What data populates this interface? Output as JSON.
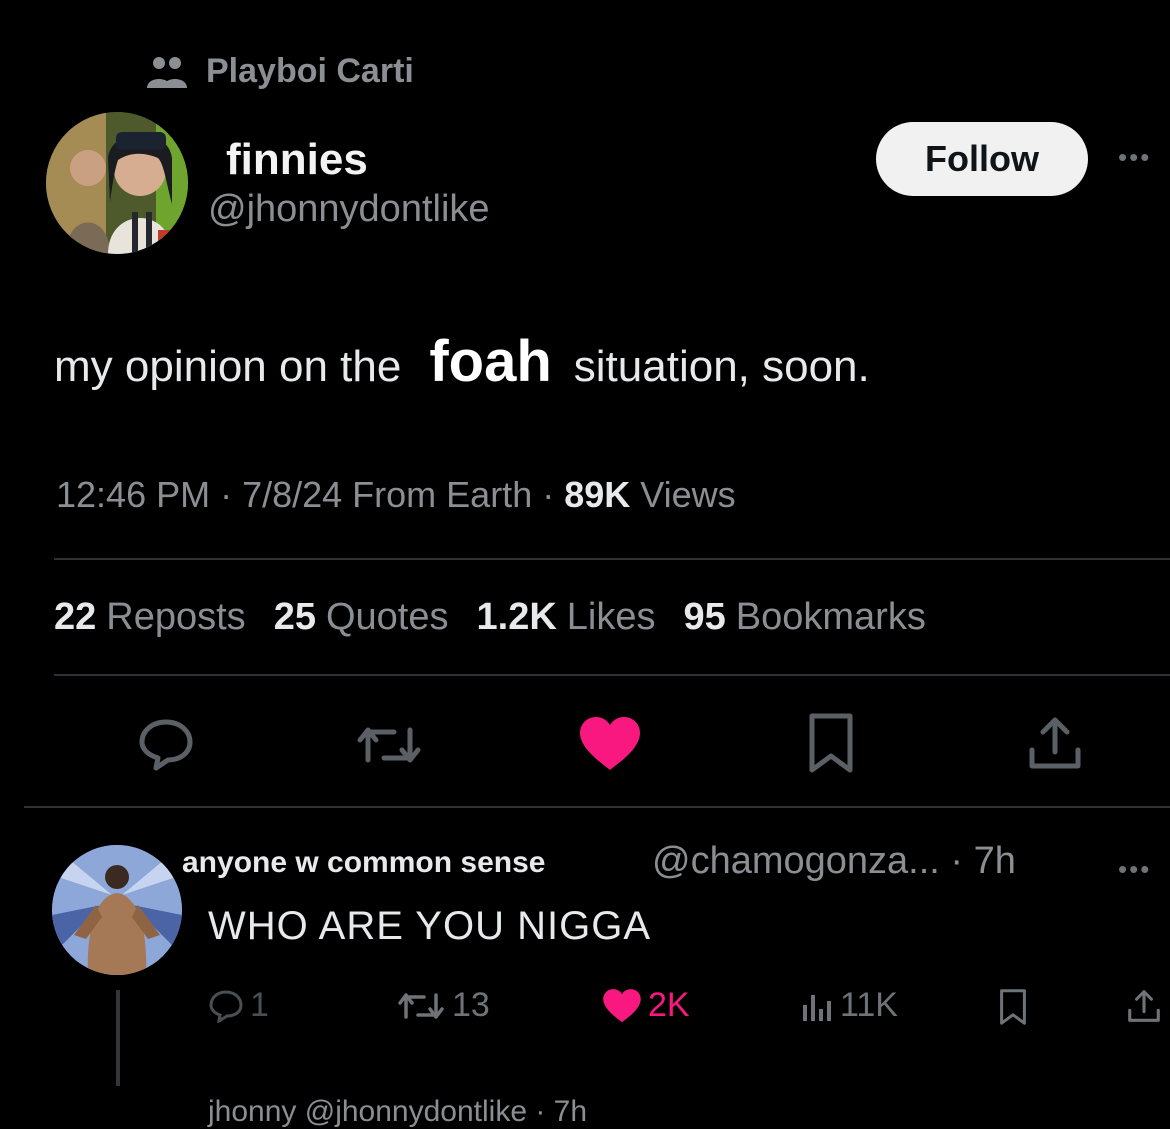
{
  "community": {
    "name": "Playboi Carti",
    "icon": "community-icon"
  },
  "tweet": {
    "display_name": "finnies",
    "handle": "@jhonnydontlike",
    "follow_label": "Follow",
    "more_label": "•••",
    "text_before": "my opinion on the",
    "text_overlay": "foah",
    "text_after": "situation, soon.",
    "time": "12:46 PM · 7/8/24 From Earth · ",
    "views_count": "89K",
    "views_label": " Views",
    "stats": [
      {
        "count": "22",
        "label": "Reposts"
      },
      {
        "count": "25",
        "label": "Quotes"
      },
      {
        "count": "1.2K",
        "label": "Likes"
      },
      {
        "count": "95",
        "label": "Bookmarks"
      }
    ],
    "actions": [
      "reply-icon",
      "repost-icon",
      "heart-icon",
      "bookmark-icon",
      "share-icon"
    ],
    "like_color": "#f91880"
  },
  "reply": {
    "display_name": "anyone w common sense",
    "handle_time": "@chamogonza... · 7h",
    "more_label": "•••",
    "text": "WHO ARE YOU NIGGA",
    "replies": "1",
    "reposts": "13",
    "likes": "2K",
    "views": "11K"
  },
  "next_reply_cutoff": "jhonny @jhonnydontlike · 7h"
}
